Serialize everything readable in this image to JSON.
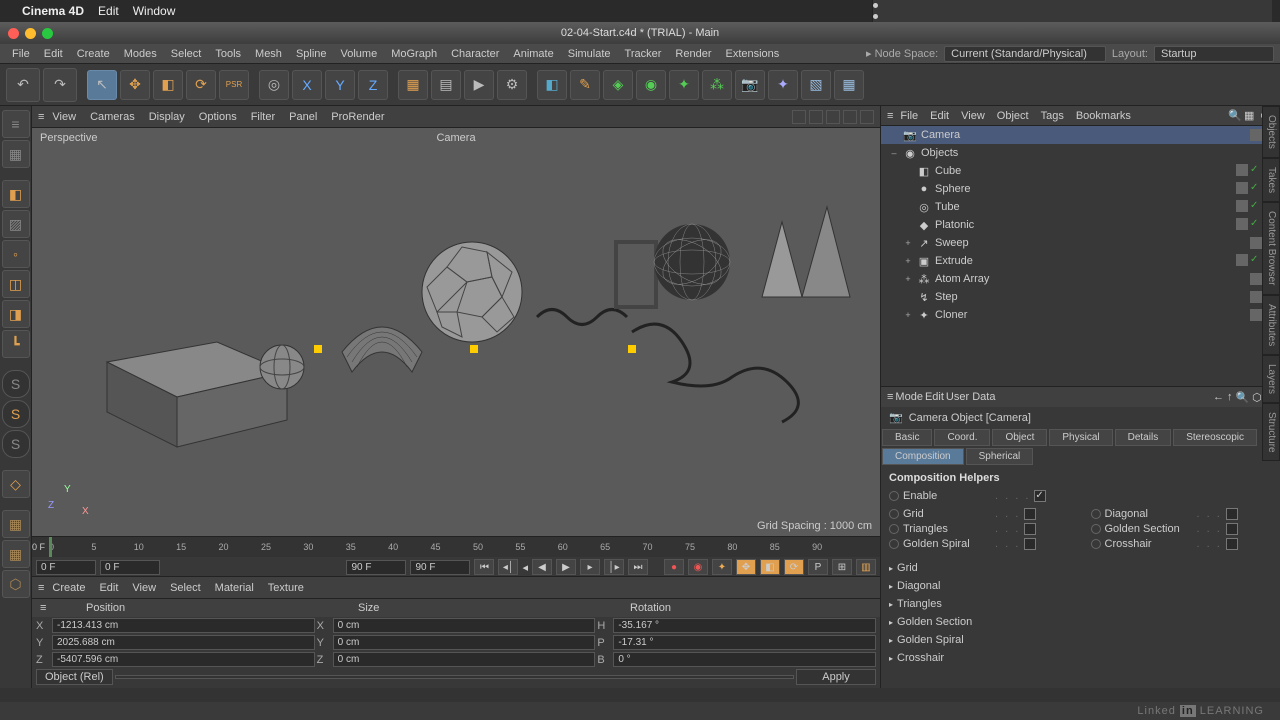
{
  "mac_menu": {
    "app": "Cinema 4D",
    "items": [
      "Edit",
      "Window"
    ]
  },
  "window_title": "02-04-Start.c4d * (TRIAL) - Main",
  "app_menu": [
    "File",
    "Edit",
    "Create",
    "Modes",
    "Select",
    "Tools",
    "Mesh",
    "Spline",
    "Volume",
    "MoGraph",
    "Character",
    "Animate",
    "Simulate",
    "Tracker",
    "Render",
    "Extensions"
  ],
  "node_space": {
    "label": "Node Space:",
    "value": "Current (Standard/Physical)"
  },
  "layout": {
    "label": "Layout:",
    "value": "Startup"
  },
  "viewport": {
    "menu": [
      "View",
      "Cameras",
      "Display",
      "Options",
      "Filter",
      "Panel",
      "ProRender"
    ],
    "type_label": "Perspective",
    "camera_label": "Camera",
    "grid_spacing": "Grid Spacing : 1000 cm"
  },
  "timeline": {
    "ticks": [
      "0",
      "5",
      "10",
      "15",
      "20",
      "25",
      "30",
      "35",
      "40",
      "45",
      "50",
      "55",
      "60",
      "65",
      "70",
      "75",
      "80",
      "85",
      "90"
    ],
    "current": "0 F",
    "start": "0 F",
    "end": "90 F",
    "end2": "90 F",
    "cur_right": "0 F"
  },
  "material_menu": [
    "Create",
    "Edit",
    "View",
    "Select",
    "Material",
    "Texture"
  ],
  "coord": {
    "headers": [
      "Position",
      "Size",
      "Rotation"
    ],
    "rows": [
      {
        "axis": "X",
        "pos": "-1213.413 cm",
        "saxis": "X",
        "size": "0 cm",
        "raxis": "H",
        "rot": "-35.167 °"
      },
      {
        "axis": "Y",
        "pos": "2025.688 cm",
        "saxis": "Y",
        "size": "0 cm",
        "raxis": "P",
        "rot": "-17.31 °"
      },
      {
        "axis": "Z",
        "pos": "-5407.596 cm",
        "saxis": "Z",
        "size": "0 cm",
        "raxis": "B",
        "rot": "0 °"
      }
    ],
    "mode": "Object (Rel)",
    "apply": "Apply"
  },
  "obj_panel_menu": [
    "File",
    "Edit",
    "View",
    "Object",
    "Tags",
    "Bookmarks"
  ],
  "objects": [
    {
      "name": "Camera",
      "exp": "",
      "icon": "📷",
      "sel": true,
      "tags": [
        "grey",
        "target"
      ]
    },
    {
      "name": "Objects",
      "exp": "–",
      "icon": "◉",
      "indent": 0,
      "tags": [
        "grey"
      ]
    },
    {
      "name": "Cube",
      "exp": "",
      "icon": "◧",
      "indent": 1,
      "tags": [
        "grey",
        "check",
        "orange"
      ]
    },
    {
      "name": "Sphere",
      "exp": "",
      "icon": "●",
      "indent": 1,
      "tags": [
        "grey",
        "check",
        "orange"
      ]
    },
    {
      "name": "Tube",
      "exp": "",
      "icon": "◎",
      "indent": 1,
      "tags": [
        "grey",
        "check",
        "orange"
      ]
    },
    {
      "name": "Platonic",
      "exp": "",
      "icon": "◆",
      "indent": 1,
      "tags": [
        "grey",
        "check",
        "orange"
      ]
    },
    {
      "name": "Sweep",
      "exp": "+",
      "icon": "↗",
      "indent": 1,
      "tags": [
        "grey",
        "check"
      ]
    },
    {
      "name": "Extrude",
      "exp": "+",
      "icon": "▣",
      "indent": 1,
      "tags": [
        "grey",
        "check",
        "orange"
      ]
    },
    {
      "name": "Atom Array",
      "exp": "+",
      "icon": "⁂",
      "indent": 1,
      "tags": [
        "grey",
        "check"
      ]
    },
    {
      "name": "Step",
      "exp": "",
      "icon": "↯",
      "indent": 1,
      "tags": [
        "grey",
        "check"
      ]
    },
    {
      "name": "Cloner",
      "exp": "+",
      "icon": "✦",
      "indent": 1,
      "tags": [
        "grey",
        "check"
      ]
    }
  ],
  "attr": {
    "menu": [
      "Mode",
      "Edit",
      "User Data"
    ],
    "title": "Camera Object [Camera]",
    "tabs": [
      "Basic",
      "Coord.",
      "Object",
      "Physical",
      "Details",
      "Stereoscopic",
      "Composition",
      "Spherical"
    ],
    "active_tab": "Composition",
    "section": "Composition Helpers",
    "enable": "Enable",
    "left_opts": [
      {
        "label": "Grid"
      },
      {
        "label": "Triangles"
      },
      {
        "label": "Golden Spiral"
      }
    ],
    "right_opts": [
      {
        "label": "Diagonal"
      },
      {
        "label": "Golden Section"
      },
      {
        "label": "Crosshair"
      }
    ],
    "collapsers": [
      "Grid",
      "Diagonal",
      "Triangles",
      "Golden Section",
      "Golden Spiral",
      "Crosshair"
    ]
  },
  "right_tabs": [
    "Objects",
    "Takes",
    "Content Browser",
    "Attributes",
    "Layers",
    "Structure"
  ],
  "footer": {
    "linked": "Linked",
    "in": "in",
    "learning": "LEARNING"
  }
}
